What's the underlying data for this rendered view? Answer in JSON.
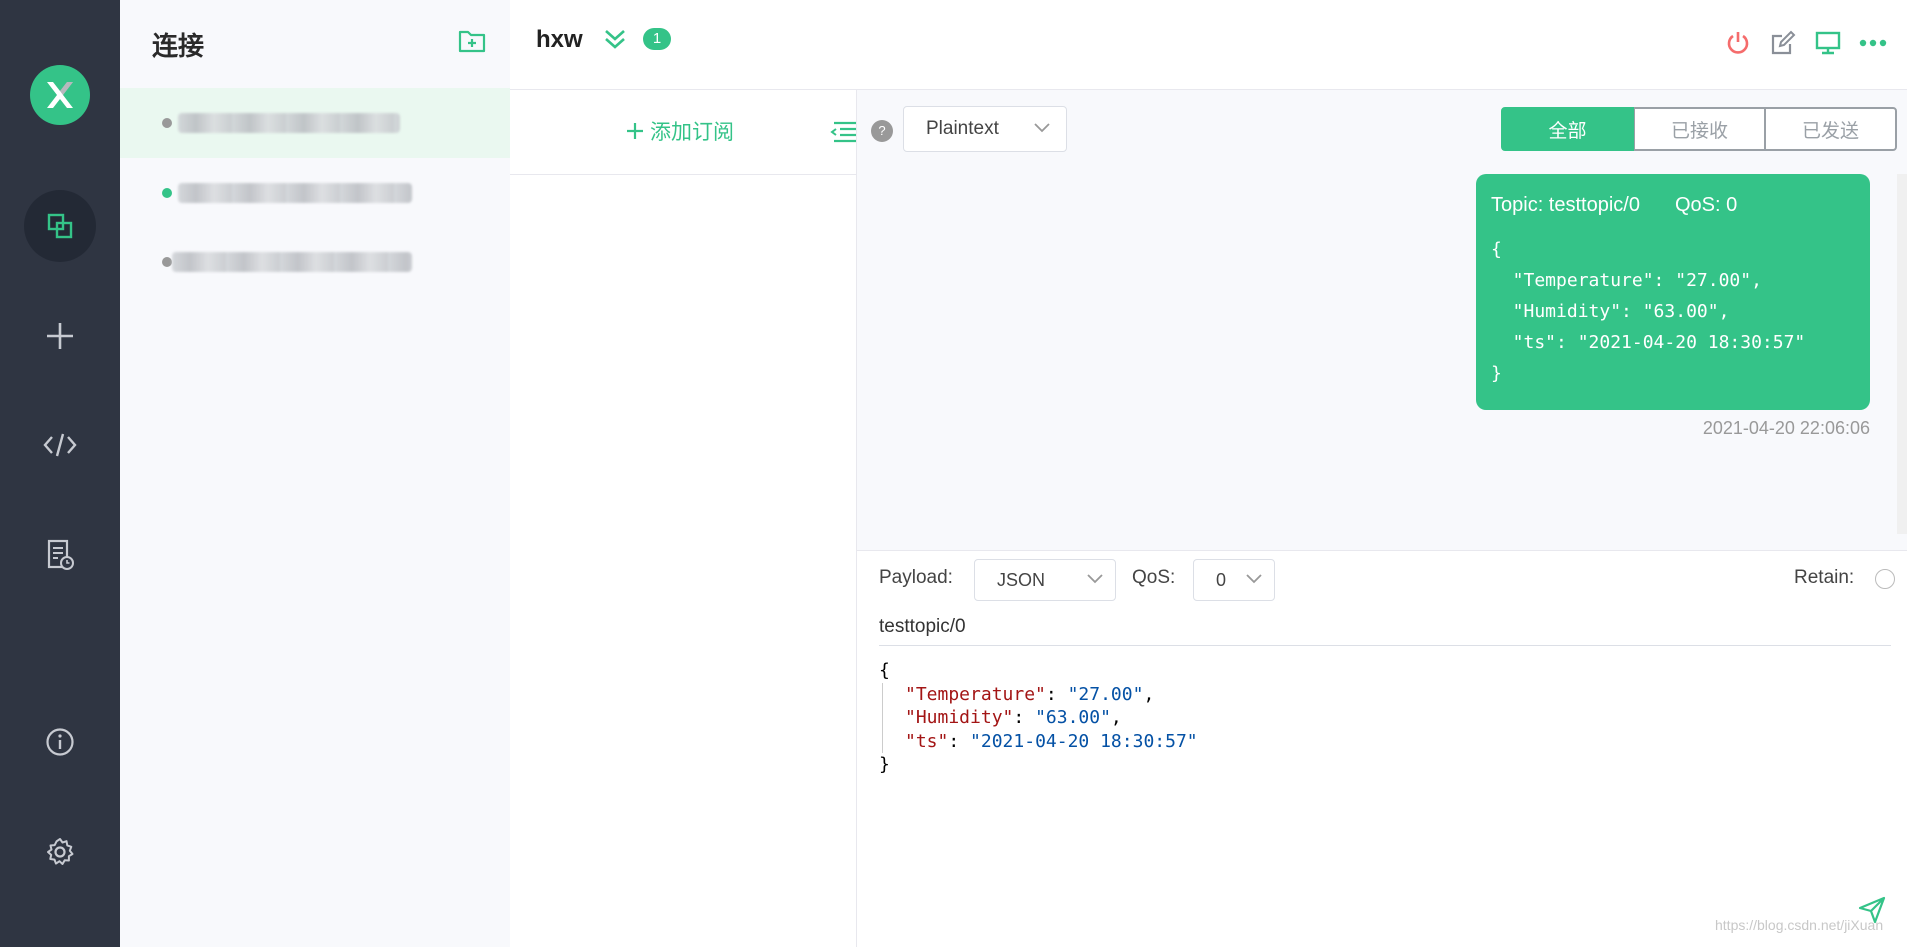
{
  "colors": {
    "accent": "#34c388",
    "rail_bg": "#2f3542",
    "power_red": "#f56c6c"
  },
  "sidebar": {
    "title": "连接",
    "connections": [
      {
        "status": "offline"
      },
      {
        "status": "online"
      },
      {
        "status": "offline"
      }
    ]
  },
  "header": {
    "connection_name": "hxw",
    "badge_count": "1"
  },
  "subscriptions": {
    "add_label": "添加订阅"
  },
  "messages": {
    "help": "?",
    "format": "Plaintext",
    "tabs": {
      "all": "全部",
      "received": "已接收",
      "sent": "已发送"
    },
    "items": [
      {
        "topic_label": "Topic: testtopic/0",
        "qos_label": "QoS: 0",
        "payload": "{\n  \"Temperature\": \"27.00\",\n  \"Humidity\": \"63.00\",\n  \"ts\": \"2021-04-20 18:30:57\"\n}",
        "time": "2021-04-20 22:06:06"
      }
    ]
  },
  "composer": {
    "payload_label": "Payload:",
    "payload_format": "JSON",
    "qos_label": "QoS:",
    "qos_value": "0",
    "retain_label": "Retain:",
    "topic": "testtopic/0",
    "payload": {
      "open": "{",
      "k1": "\"Temperature\"",
      "v1": "\"27.00\"",
      "k2": "\"Humidity\"",
      "v2": "\"63.00\"",
      "k3": "\"ts\"",
      "v3": "\"2021-04-20 18:30:57\"",
      "close": "}"
    }
  },
  "watermark": "https://blog.csdn.net/jiXuan",
  "icons": [
    "logo-icon",
    "connections-icon",
    "plus-icon",
    "code-icon",
    "log-icon",
    "info-icon",
    "settings-icon",
    "new-folder-icon",
    "double-chevron-icon",
    "power-icon",
    "edit-icon",
    "monitor-icon",
    "more-icon",
    "collapse-icon",
    "chevron-down-icon",
    "send-icon"
  ]
}
